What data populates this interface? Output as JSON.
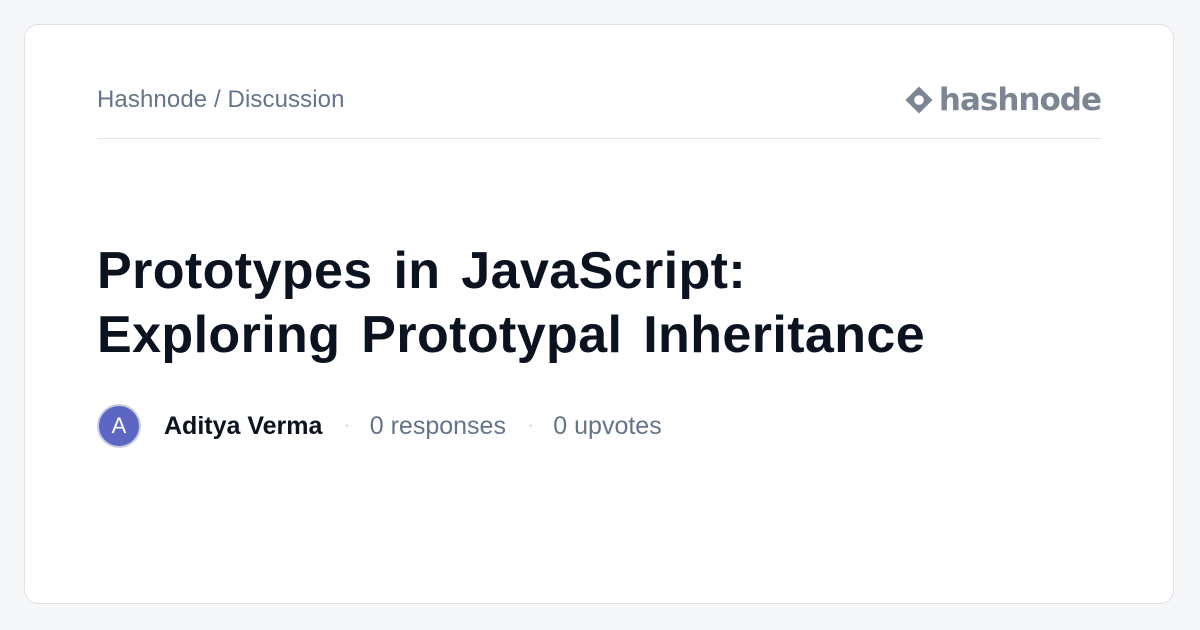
{
  "breadcrumb": "Hashnode / Discussion",
  "brand": {
    "name": "hashnode",
    "icon": "hashnode-logo-icon"
  },
  "title_lines": [
    "Prototypes in JavaScript:",
    "Exploring Prototypal Inheritance"
  ],
  "author": {
    "initial": "A",
    "name": "Aditya Verma",
    "avatar_color": "#5b67c2"
  },
  "stats": {
    "responses": "0 responses",
    "upvotes": "0 upvotes",
    "separator": "·"
  },
  "colors": {
    "background": "#f6f7f9",
    "card": "#ffffff",
    "title": "#0b1220",
    "muted": "#64748b",
    "brand": "#7c8594"
  }
}
